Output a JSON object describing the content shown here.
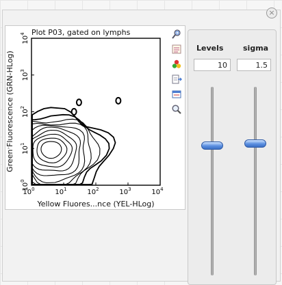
{
  "plot": {
    "title": "Plot P03, gated on lymphs",
    "ylabel": "Green Fluorescence (GRN-HLog)",
    "xlabel": "Yellow Fluores...nce (YEL-HLog)",
    "x_ticks": [
      "10",
      "10",
      "10",
      "10",
      "10"
    ],
    "x_exps": [
      "0",
      "1",
      "2",
      "3",
      "4"
    ],
    "y_ticks": [
      "10",
      "10",
      "10",
      "10",
      "10"
    ],
    "y_exps": [
      "0",
      "1",
      "2",
      "3",
      "4"
    ]
  },
  "tools": [
    {
      "name": "zoom-fit-icon"
    },
    {
      "name": "notes-icon"
    },
    {
      "name": "color-palette-icon"
    },
    {
      "name": "export-icon"
    },
    {
      "name": "window-icon"
    },
    {
      "name": "magnifier-icon"
    }
  ],
  "controls": {
    "levels_label": "Levels",
    "sigma_label": "sigma",
    "levels_value": "10",
    "sigma_value": "1.5",
    "levels_level": 0.69,
    "sigma_level": 0.7
  },
  "window": {
    "close_icon": "close-icon",
    "side_mark": "1"
  },
  "chart_data": {
    "type": "contour",
    "title": "Plot P03, gated on lymphs",
    "xlabel": "Yellow Fluores...nce (YEL-HLog)",
    "ylabel": "Green Fluorescence (GRN-HLog)",
    "x_scale": "log",
    "y_scale": "log",
    "xlim": [
      1,
      10000
    ],
    "ylim": [
      1,
      10000
    ],
    "levels": 10,
    "sigma": 1.5,
    "peak": [
      4,
      10
    ],
    "outliers": [
      [
        21,
        100
      ],
      [
        30,
        180
      ],
      [
        500,
        200
      ]
    ]
  }
}
